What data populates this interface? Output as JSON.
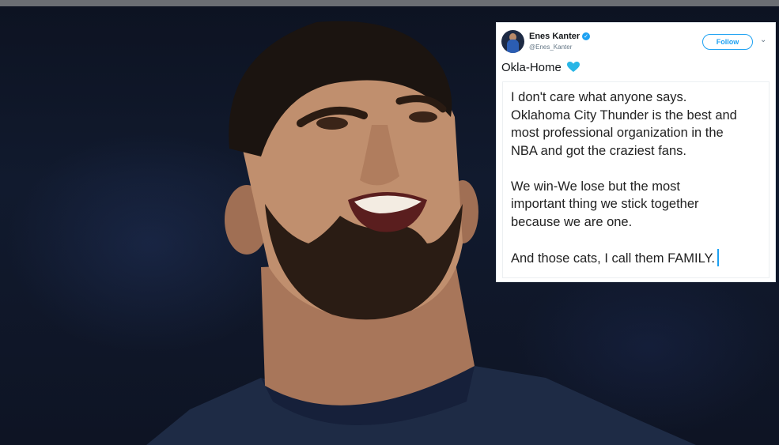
{
  "tweet": {
    "display_name": "Enes Kanter",
    "handle": "@Enes_Kanter",
    "follow_label": "Follow",
    "text": "Okla-Home",
    "heart_emoji": "blue-heart",
    "note_paragraphs": [
      "I don't care what anyone says.",
      "Oklahoma City Thunder is the best and",
      "most professional organization in the",
      "NBA and got the craziest fans.",
      "We win-We lose but the most",
      "important thing we stick together",
      "because we are one.",
      "And those cats, I call them FAMILY."
    ]
  },
  "colors": {
    "twitter_blue": "#1da1f2",
    "background": "#0b0f1a",
    "jersey": "#1e2b45"
  }
}
